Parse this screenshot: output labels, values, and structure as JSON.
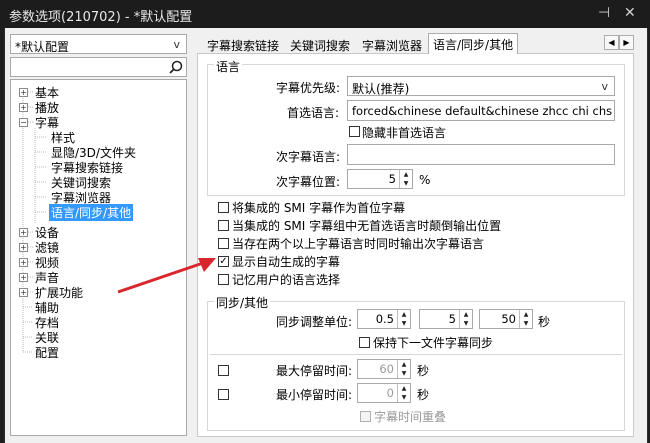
{
  "window": {
    "title": "参数选项(210702) - *默认配置",
    "pin_glyph": "⊣",
    "close_glyph": "✕"
  },
  "profile": {
    "selected": "*默认配置",
    "arrow": "v"
  },
  "search": {
    "value": "",
    "placeholder": ""
  },
  "tree": {
    "items": [
      {
        "label": "基本",
        "expander": "+"
      },
      {
        "label": "播放",
        "expander": "+"
      },
      {
        "label": "字幕",
        "expander": "−"
      },
      {
        "label": "样式"
      },
      {
        "label": "显隐/3D/文件夹"
      },
      {
        "label": "字幕搜索链接"
      },
      {
        "label": "关键词搜索"
      },
      {
        "label": "字幕浏览器"
      },
      {
        "label": "语言/同步/其他"
      },
      {
        "label": "设备",
        "expander": "+"
      },
      {
        "label": "滤镜",
        "expander": "+"
      },
      {
        "label": "视频",
        "expander": "+"
      },
      {
        "label": "声音",
        "expander": "+"
      },
      {
        "label": "扩展功能",
        "expander": "+"
      },
      {
        "label": "辅助"
      },
      {
        "label": "存档"
      },
      {
        "label": "关联"
      },
      {
        "label": "配置"
      }
    ]
  },
  "tabs": {
    "items": [
      "字幕搜索链接",
      "关键词搜索",
      "字幕浏览器",
      "语言/同步/其他"
    ],
    "active": "语言/同步/其他",
    "prev": "◀",
    "next": "▶"
  },
  "language": {
    "group_label": "语言",
    "priority_label": "字幕优先级:",
    "priority_value": "默认(推荐)",
    "primary_label": "首选语言:",
    "primary_value": "forced&chinese default&chinese zhcc chi chs zh chinese",
    "hide_nonpreferred_label": "隐藏非首选语言",
    "secondary_label": "次字幕语言:",
    "secondary_value": "",
    "secondary_pos_label": "次字幕位置:",
    "secondary_pos_value": "5",
    "secondary_pos_unit": "%"
  },
  "options": {
    "items": [
      {
        "label": "将集成的 SMI 字幕作为首位字幕",
        "checked": false
      },
      {
        "label": "当集成的 SMI 字幕组中无首选语言时颠倒输出位置",
        "checked": false
      },
      {
        "label": "当存在两个以上字幕语言时同时输出次字幕语言",
        "checked": false
      },
      {
        "label": "显示自动生成的字幕",
        "checked": true
      },
      {
        "label": "记忆用户的语言选择",
        "checked": false
      }
    ]
  },
  "sync": {
    "group_label": "同步/其他",
    "unit_label": "同步调整单位:",
    "unit_values": [
      "0.5",
      "5",
      "50"
    ],
    "unit_suffix": "秒",
    "keep_sync_label": "保持下一文件字幕同步",
    "max_label": "最大停留时间:",
    "max_value": "60",
    "max_unit": "秒",
    "min_label": "最小停留时间:",
    "min_value": "0",
    "min_unit": "秒",
    "overlap_label": "字幕时间重叠"
  },
  "annotation": {
    "arrow_color": "#d9262c"
  },
  "check_glyph": "✓"
}
